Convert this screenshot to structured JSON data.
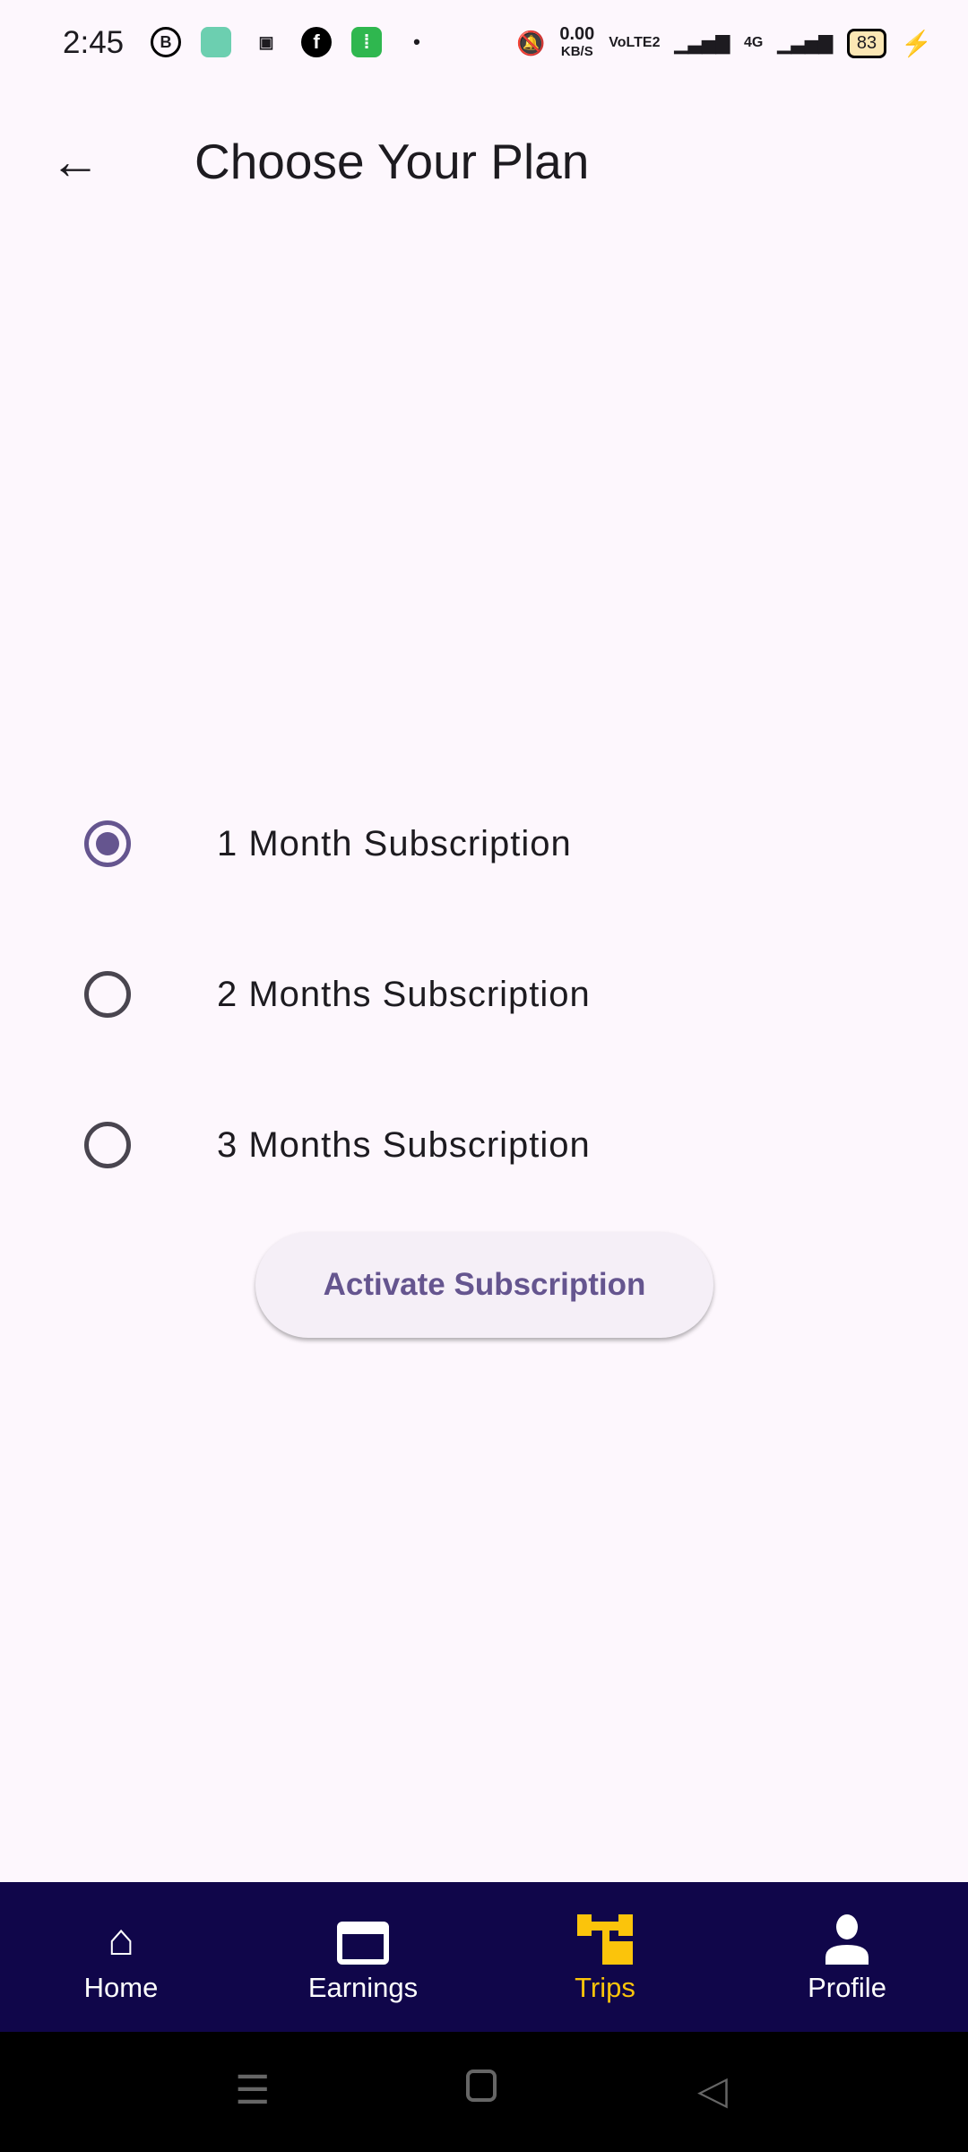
{
  "status_bar": {
    "time": "2:45",
    "net_speed": "0.00",
    "net_unit": "KB/S",
    "volte": "VoLTE2",
    "network": "4G",
    "battery": "83",
    "notification_icons": [
      "business-chat-icon",
      "app-icon",
      "video-icon",
      "facebook-icon",
      "green-app-icon",
      "dot-icon"
    ]
  },
  "header": {
    "title": "Choose Your Plan"
  },
  "plans": {
    "selected": 0,
    "options": [
      {
        "label": "1 Month Subscription"
      },
      {
        "label": "2 Months Subscription"
      },
      {
        "label": "3 Months Subscription"
      }
    ]
  },
  "activate_label": "Activate Subscription",
  "colors": {
    "accent": "#65558f",
    "nav_bg": "#10064a",
    "nav_active": "#fbc40b",
    "background": "#fdf7fd"
  },
  "bottom_nav": {
    "active": 2,
    "items": [
      {
        "label": "Home",
        "icon": "home-icon"
      },
      {
        "label": "Earnings",
        "icon": "card-icon"
      },
      {
        "label": "Trips",
        "icon": "trips-icon"
      },
      {
        "label": "Profile",
        "icon": "person-icon"
      }
    ]
  }
}
